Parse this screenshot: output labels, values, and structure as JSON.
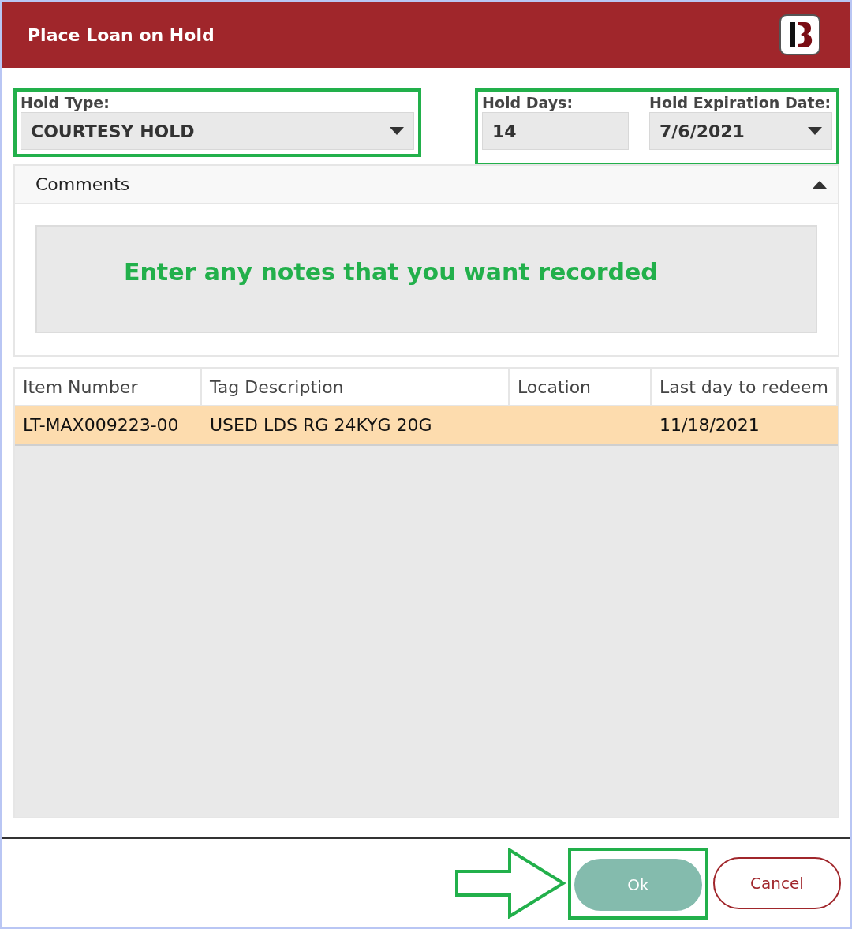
{
  "window": {
    "title": "Place Loan on Hold"
  },
  "hold_type": {
    "label": "Hold Type:",
    "value": "COURTESY HOLD"
  },
  "hold_days": {
    "label": "Hold Days:",
    "value": "14"
  },
  "hold_expiration_date": {
    "label": "Hold Expiration Date:",
    "value": "7/6/2021"
  },
  "comments": {
    "title": "Comments",
    "expanded": true,
    "annotation": "Enter any notes that you want recorded"
  },
  "table": {
    "columns": [
      "Item Number",
      "Tag Description",
      "Location",
      "Last day to redeem"
    ],
    "rows": [
      {
        "cells": [
          "LT-MAX009223-00",
          "USED LDS RG 24KYG 20G",
          "",
          "11/18/2021"
        ],
        "selected": true
      }
    ]
  },
  "buttons": [
    {
      "label": "Ok",
      "kind": "primary"
    },
    {
      "label": "Cancel",
      "kind": "secondary"
    }
  ]
}
